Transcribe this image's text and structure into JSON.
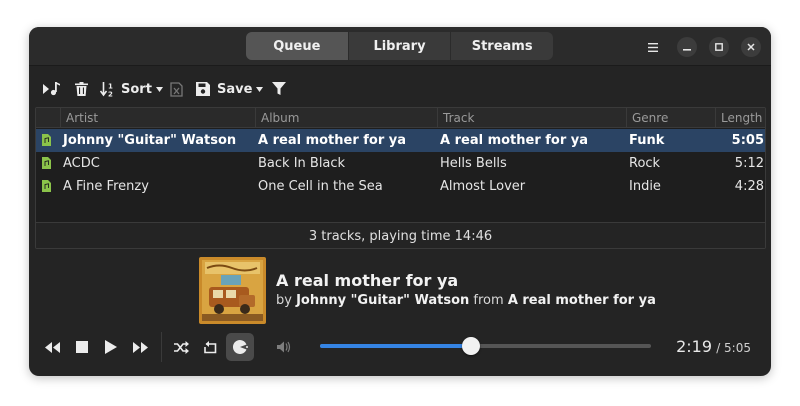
{
  "header": {
    "tabs": [
      {
        "label": "Queue",
        "active": true
      },
      {
        "label": "Library",
        "active": false
      },
      {
        "label": "Streams",
        "active": false
      }
    ],
    "window_controls": [
      "menu-icon",
      "minimize-icon",
      "maximize-icon",
      "close-icon"
    ]
  },
  "toolbar": {
    "sort_label": "Sort",
    "save_label": "Save"
  },
  "table": {
    "columns": [
      "Artist",
      "Album",
      "Track",
      "Genre",
      "Length"
    ],
    "rows": [
      {
        "artist": "Johnny \"Guitar\" Watson",
        "album": "A real mother for ya",
        "track": "A real mother for ya",
        "genre": "Funk",
        "length": "5:05",
        "selected": true
      },
      {
        "artist": "ACDC",
        "album": "Back In Black",
        "track": "Hells Bells",
        "genre": "Rock",
        "length": "5:12",
        "selected": false
      },
      {
        "artist": "A Fine Frenzy",
        "album": "One Cell in the Sea",
        "track": "Almost Lover",
        "genre": "Indie",
        "length": "4:28",
        "selected": false
      }
    ],
    "summary": "3 tracks, playing time 14:46"
  },
  "now_playing": {
    "title": "A real mother for ya",
    "by_label": "by",
    "artist": "Johnny \"Guitar\" Watson",
    "from_label": "from",
    "album": "A real mother for ya"
  },
  "playback": {
    "elapsed": "2:19",
    "total": "/ 5:05",
    "progress_fraction": 0.455,
    "accent_color": "#3584e4"
  }
}
